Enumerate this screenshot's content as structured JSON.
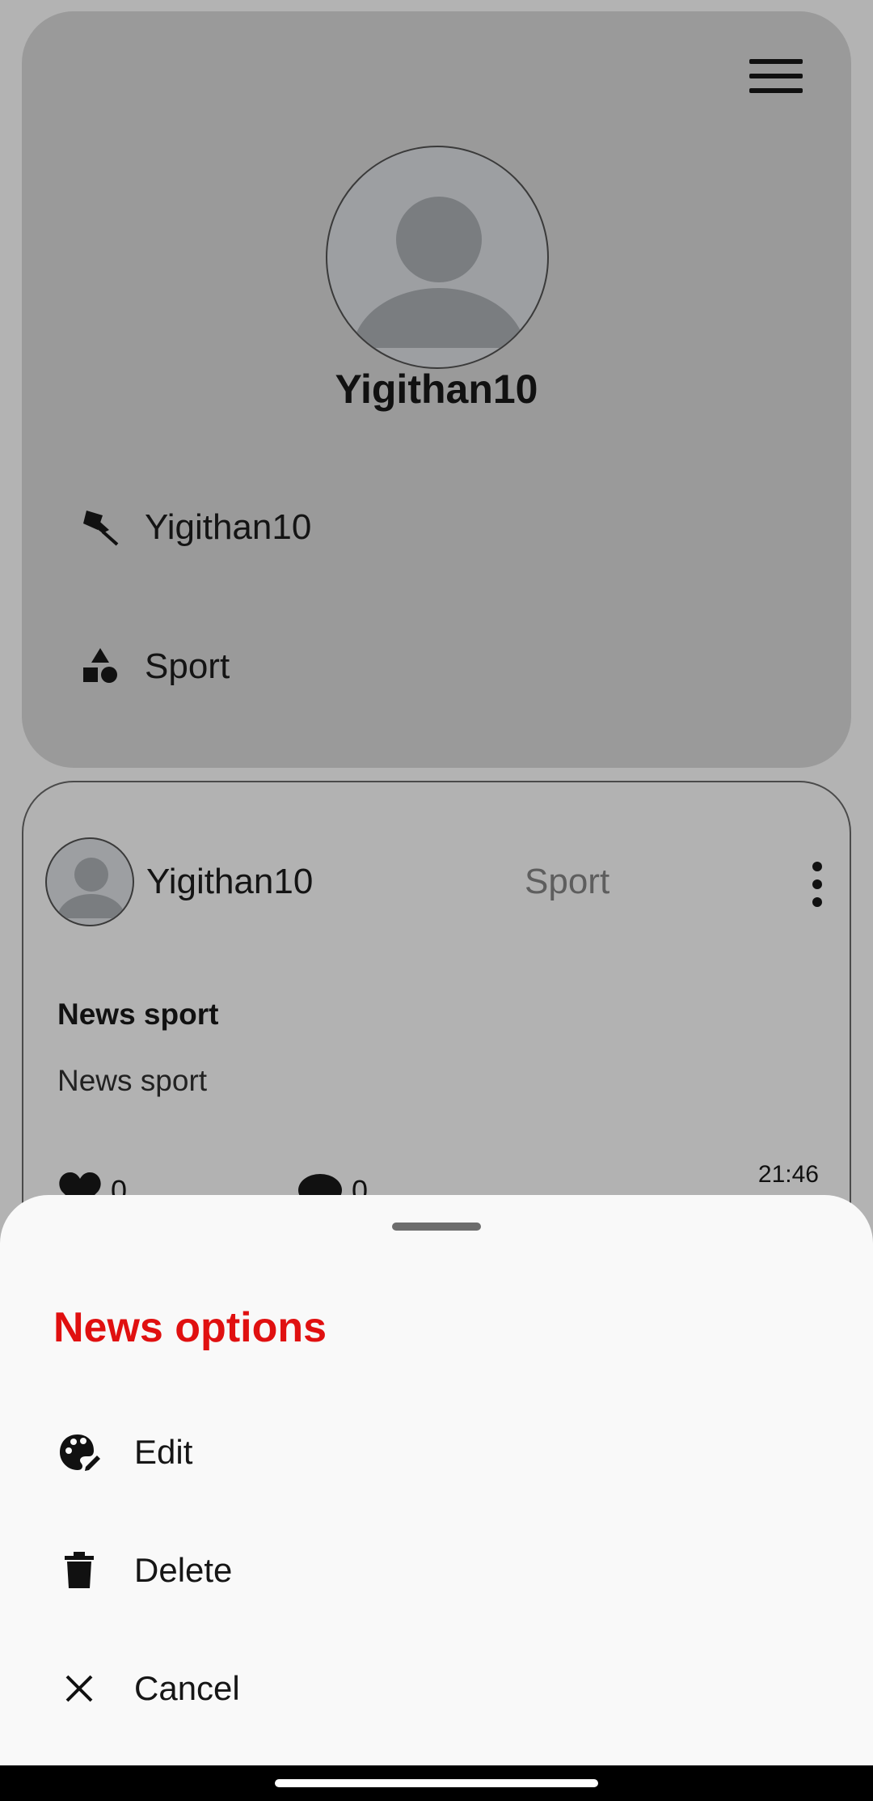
{
  "profile": {
    "username": "Yigithan10",
    "info_rows": [
      {
        "icon": "pin-off-icon",
        "text": "Yigithan10"
      },
      {
        "icon": "category-shapes-icon",
        "text": "Sport"
      }
    ]
  },
  "news_card": {
    "author": "Yigithan10",
    "category": "Sport",
    "title": "News sport",
    "body": "News sport",
    "time": "21:46",
    "likes": "0",
    "comments": "0"
  },
  "sheet": {
    "title": "News options",
    "items": [
      {
        "icon": "edit-palette-icon",
        "label": "Edit"
      },
      {
        "icon": "trash-icon",
        "label": "Delete"
      },
      {
        "icon": "close-icon",
        "label": "Cancel"
      }
    ]
  },
  "colors": {
    "accent": "#e01010",
    "sheet_bg": "#f9f9f9",
    "card_bg": "#9a9a9a"
  }
}
